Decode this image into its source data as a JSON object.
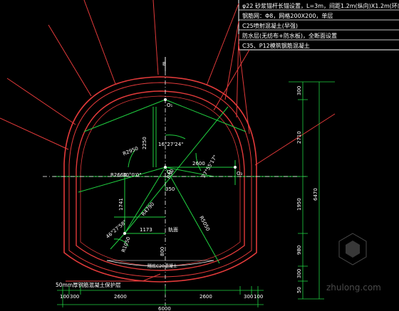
{
  "notes": {
    "line1": "φ22 砂浆锚杆长锚设置，L=3m，间距1.2m(纵向)X1.2m(环向)",
    "line2": "钢筋网：Φ8，网格200X200，单层",
    "line3": "C25喷射混凝土(早强)",
    "line4": "防水层(无纺布+防水板)，全断面设置",
    "line5": "C35、P12模筑钢筋混凝土"
  },
  "labels": {
    "top_marker": "B",
    "o1": "O₁",
    "o2": "O₂",
    "o3": "O₃",
    "angle_top": "16°27'24\"",
    "angle_left": "30°0'0\"",
    "angle_right": "27°55'17\"",
    "angle_bottom": "46°27'58\"",
    "r_upper": "R2950",
    "r_left": "R2660",
    "r_bottom": "R4790",
    "r_right": "R5050",
    "r_corner": "R1050",
    "r_center": "R50",
    "dim_2250": "2250",
    "dim_2600_mid": "2600",
    "dim_350": "350",
    "dim_1741": "1741",
    "dim_1173": "1173",
    "rail_label": "轨面",
    "dim_800": "800",
    "base_label": "隧底C20混凝土",
    "lining_note": "50mm厚钢筋混凝土保护层"
  },
  "right_dims": {
    "d1": "300",
    "d2": "2710",
    "d3": "1950",
    "d4": "980",
    "d5": "300",
    "d6": "50",
    "total": "6470"
  },
  "bottom_dims": {
    "left_small": "100",
    "left_300": "300",
    "left_2600": "2600",
    "right_2600": "2600",
    "right_300": "300",
    "right_small": "100",
    "total": "6000"
  },
  "watermark": "zhulong.com",
  "colors": {
    "background": "#000000",
    "lining": "#e23a3a",
    "construction": "#20d040",
    "notes": "#ffffff",
    "centerline": "#ffffff",
    "dim_text": "#e0e040"
  }
}
